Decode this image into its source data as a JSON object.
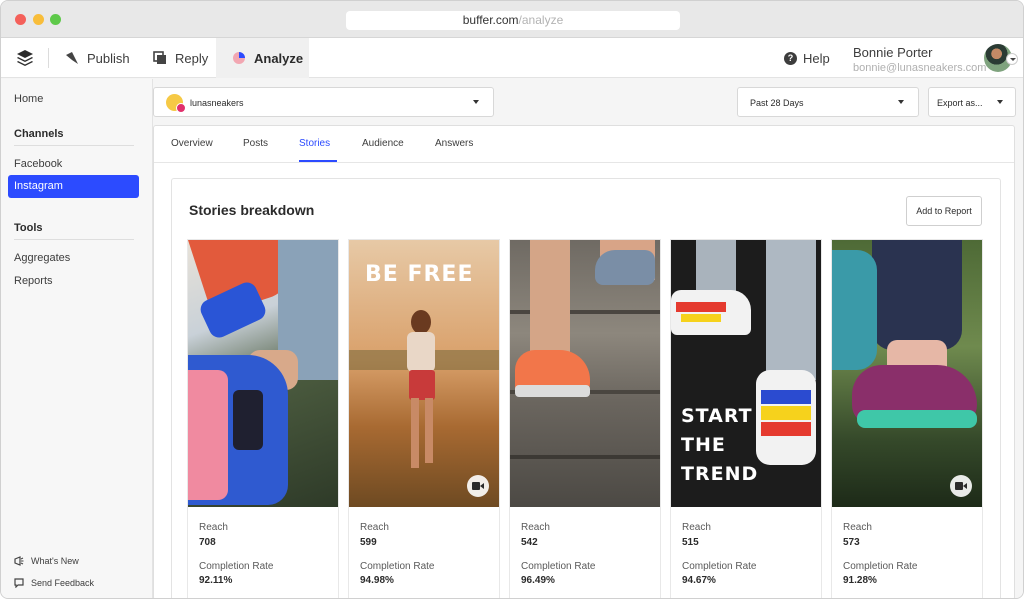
{
  "browser": {
    "url_host": "buffer.com",
    "url_path": "/analyze"
  },
  "nav": {
    "publish": "Publish",
    "reply": "Reply",
    "analyze": "Analyze",
    "help": "Help",
    "user_name": "Bonnie Porter",
    "user_email": "bonnie@lunasneakers.com"
  },
  "sidebar": {
    "home": "Home",
    "channels_heading": "Channels",
    "facebook": "Facebook",
    "instagram": "Instagram",
    "tools_heading": "Tools",
    "aggregates": "Aggregates",
    "reports": "Reports",
    "whats_new": "What's New",
    "send_feedback": "Send Feedback"
  },
  "toolbar": {
    "account": "lunasneakers",
    "date_range": "Past 28 Days",
    "export": "Export as..."
  },
  "tabs": [
    "Overview",
    "Posts",
    "Stories",
    "Audience",
    "Answers"
  ],
  "active_tab": "Stories",
  "breakdown": {
    "title": "Stories breakdown",
    "add_to_report": "Add to Report"
  },
  "stories": [
    {
      "reach_label": "Reach",
      "reach": "708",
      "completion_label": "Completion Rate",
      "completion": "92.11%",
      "overlay": "",
      "video": false
    },
    {
      "reach_label": "Reach",
      "reach": "599",
      "completion_label": "Completion Rate",
      "completion": "94.98%",
      "overlay": "BE FREE",
      "video": true
    },
    {
      "reach_label": "Reach",
      "reach": "542",
      "completion_label": "Completion Rate",
      "completion": "96.49%",
      "overlay": "",
      "video": false
    },
    {
      "reach_label": "Reach",
      "reach": "515",
      "completion_label": "Completion Rate",
      "completion": "94.67%",
      "overlay": "START THE TREND",
      "video": false
    },
    {
      "reach_label": "Reach",
      "reach": "573",
      "completion_label": "Completion Rate",
      "completion": "91.28%",
      "overlay": "",
      "video": true
    }
  ],
  "colors": {
    "accent": "#2c4bff",
    "instagram_badge": "#e1306c"
  }
}
